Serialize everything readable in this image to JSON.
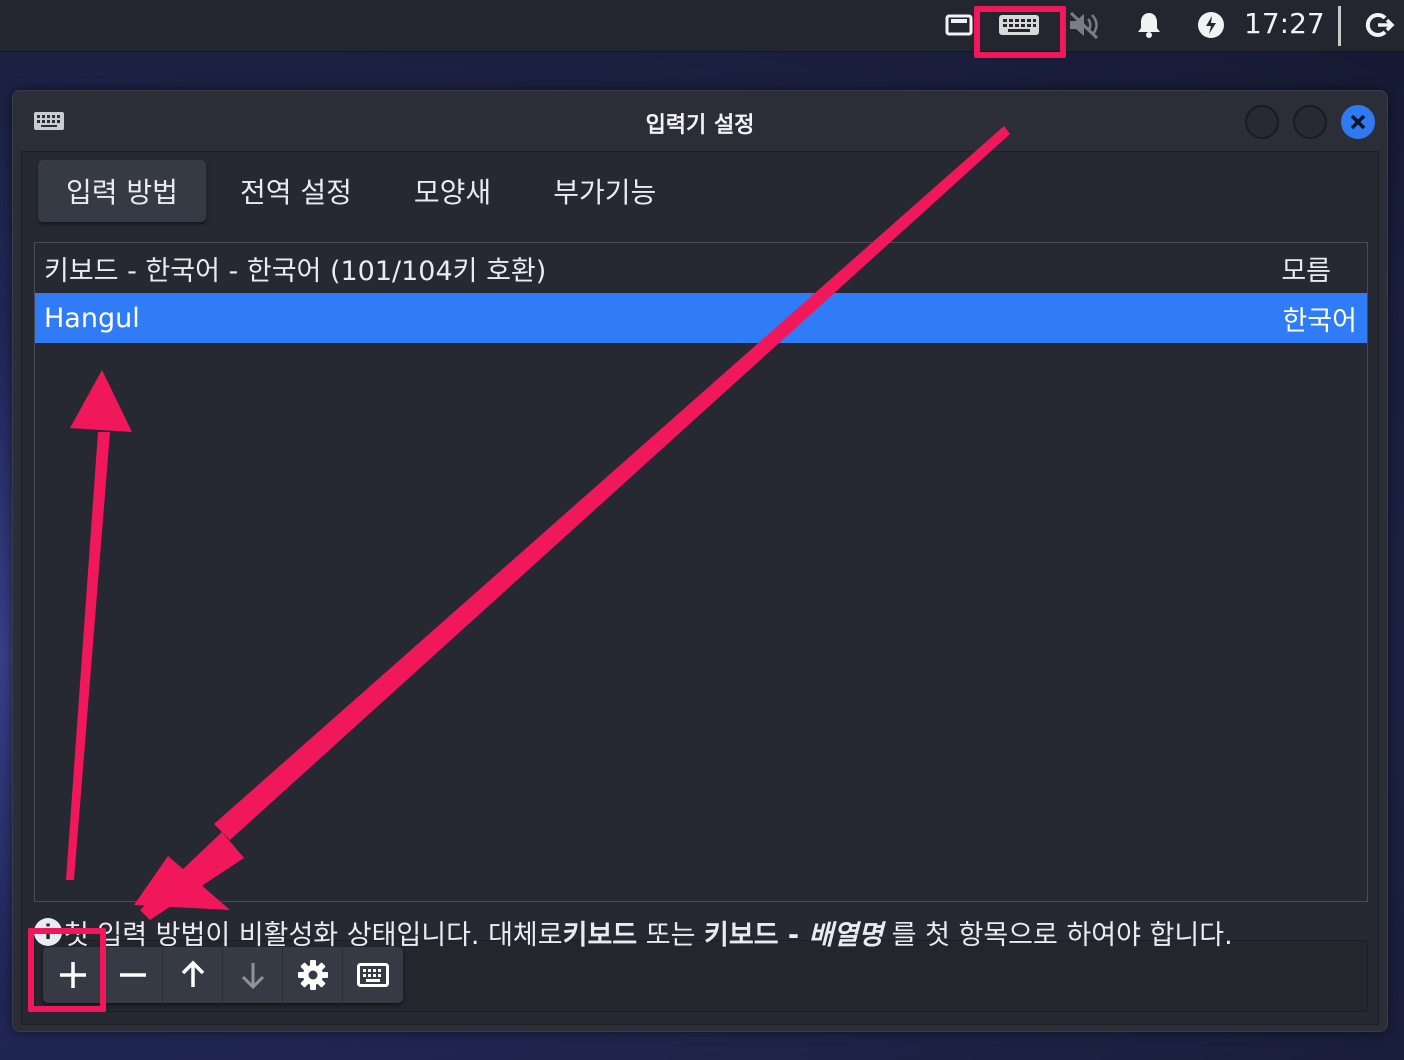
{
  "top_panel": {
    "clock": "17:27",
    "icons": [
      "window-list-icon",
      "keyboard-icon",
      "speaker-muted-icon",
      "bell-icon",
      "power-icon",
      "logout-icon"
    ]
  },
  "dialog": {
    "title": "입력기 설정",
    "tabs": [
      {
        "label": "입력 방법",
        "active": true
      },
      {
        "label": "전역 설정",
        "active": false
      },
      {
        "label": "모양새",
        "active": false
      },
      {
        "label": "부가기능",
        "active": false
      }
    ],
    "input_methods": [
      {
        "name": "키보드 - 한국어 - 한국어 (101/104키 호환)",
        "language": "모름",
        "selected": false
      },
      {
        "name": "Hangul",
        "language": "한국어",
        "selected": true
      }
    ],
    "status": {
      "part1": "첫 입력 방법이 비활성화 상태입니다. 대체로 ",
      "bold1": "키보드",
      "part2": " 또는 ",
      "bold2": "키보드 - ",
      "italic": "배열명",
      "part3": " 를 첫 항목으로 하여야 합니다."
    },
    "toolbar": [
      "add-icon",
      "remove-icon",
      "move-up-icon",
      "move-down-icon",
      "configure-icon",
      "keyboard-layout-icon"
    ]
  },
  "colors": {
    "highlight": "#f0185a",
    "selection": "#2f7cf6",
    "close_button": "#2f7af0"
  }
}
